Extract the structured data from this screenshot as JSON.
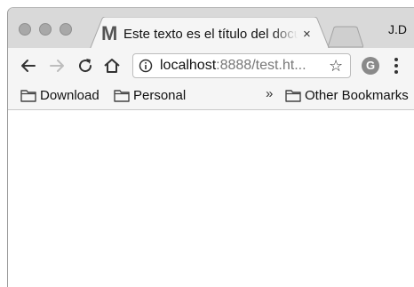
{
  "tab": {
    "favicon_letter": "M",
    "title": "Este texto es el título del documento",
    "close_label": "×"
  },
  "profile": {
    "label": "J.D"
  },
  "omnibox": {
    "url_host": "localhost",
    "url_rest": ":8888/test.ht...",
    "star_label": "☆"
  },
  "extension": {
    "letter": "G"
  },
  "bookmarks": {
    "items": [
      {
        "label": "Download"
      },
      {
        "label": "Personal"
      }
    ],
    "overflow_label": "»",
    "other_label": "Other Bookmarks"
  },
  "colors": {
    "titlebar": "#d9d9d9",
    "toolbar": "#f5f5f5",
    "content": "#ffffff"
  }
}
